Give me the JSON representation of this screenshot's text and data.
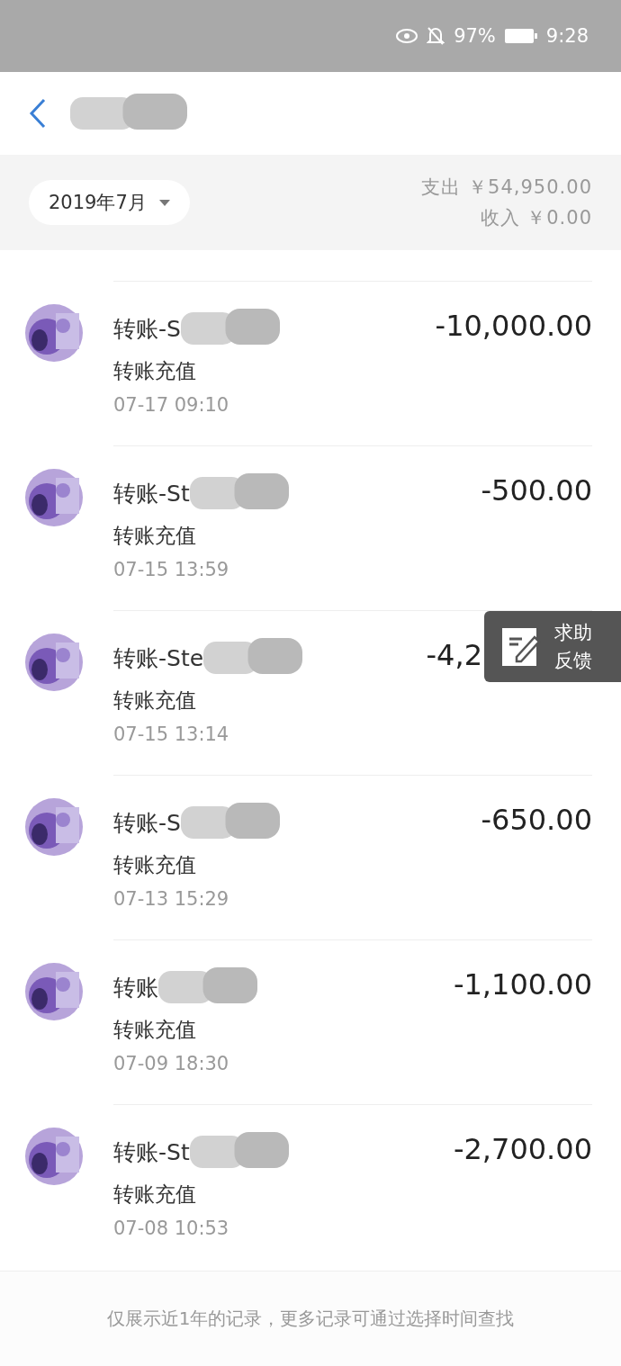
{
  "status_bar": {
    "battery": "97%",
    "time": "9:28"
  },
  "summary": {
    "month": "2019年7月",
    "expense": "支出 ￥54,950.00",
    "income": "收入 ￥0.00"
  },
  "records": [
    {
      "title": "转账-S",
      "subtitle": "转账充值",
      "time": "07-17  09:10",
      "amount": "-10,000.00",
      "covered": false
    },
    {
      "title": "转账-St",
      "subtitle": "转账充值",
      "time": "07-15  13:59",
      "amount": "-500.00",
      "covered": false
    },
    {
      "title": "转账-Ste",
      "subtitle": "转账充值",
      "time": "07-15  13:14",
      "amount": "-4,2",
      "covered": true
    },
    {
      "title": "转账-S",
      "subtitle": "转账充值",
      "time": "07-13  15:29",
      "amount": "-650.00",
      "covered": false
    },
    {
      "title": "转账",
      "subtitle": "转账充值",
      "time": "07-09  18:30",
      "amount": "-1,100.00",
      "covered": false
    },
    {
      "title": "转账-St",
      "subtitle": "转账充值",
      "time": "07-08  10:53",
      "amount": "-2,700.00",
      "covered": false
    }
  ],
  "feedback_button": {
    "line_1": "求助",
    "line_2": "反馈"
  },
  "footer": {
    "note": "仅展示近1年的记录，更多记录可通过选择时间查找"
  }
}
